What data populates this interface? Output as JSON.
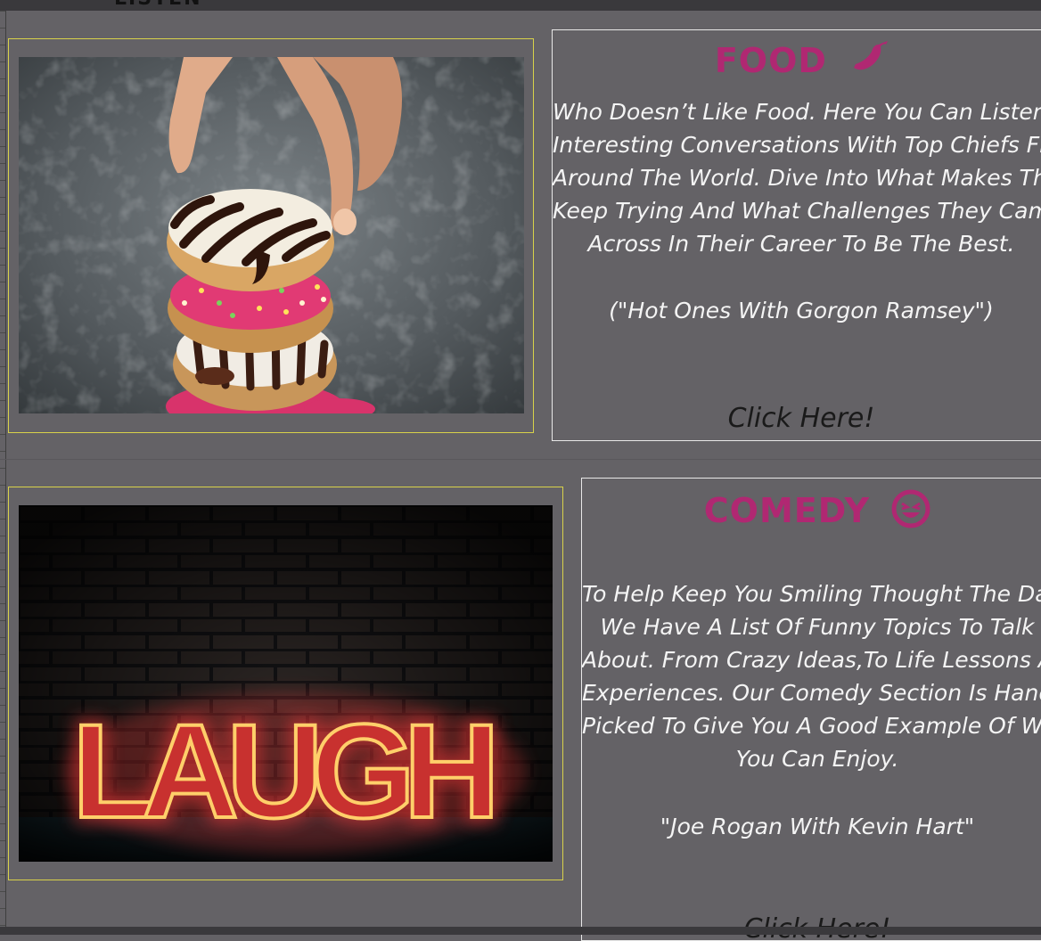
{
  "header": {
    "partial_title": "LISTEN"
  },
  "sections": [
    {
      "title": "FOOD",
      "title_icon": "chili-pepper-icon",
      "image_label": "donut-stack-photo",
      "description_lines": [
        "Who Doesn’t Like Food. Here You Can Listen To",
        "Interesting Conversations With Top Chiefs From",
        "Around The World. Dive Into What Makes Them",
        "Keep Trying And What Challenges They Came",
        "Across In Their Career To Be The Best."
      ],
      "quote": "(\"Hot Ones With Gorgon Ramsey\")",
      "cta": "Click Here!"
    },
    {
      "title": "COMEDY",
      "title_icon": "laughing-face-icon",
      "image_label": "laugh-neon-sign-photo",
      "image_text": "LAUGH",
      "description_lines": [
        "To Help Keep You Smiling Thought The Day,",
        "We Have A List Of Funny Topics To Talk",
        "About. From Crazy Ideas,To Life Lessons And",
        "Experiences. Our Comedy Section Is Hand",
        "Picked To Give You A Good Example Of What",
        "You Can Enjoy."
      ],
      "quote": "\"Joe Rogan With Kevin Hart\"",
      "cta": "Click Here!"
    }
  ],
  "colors": {
    "background": "#646266",
    "title_accent": "#b02872",
    "image_border": "#d8d24a",
    "panel_border": "#e8e8e8",
    "neon": "#ff3a3a"
  }
}
